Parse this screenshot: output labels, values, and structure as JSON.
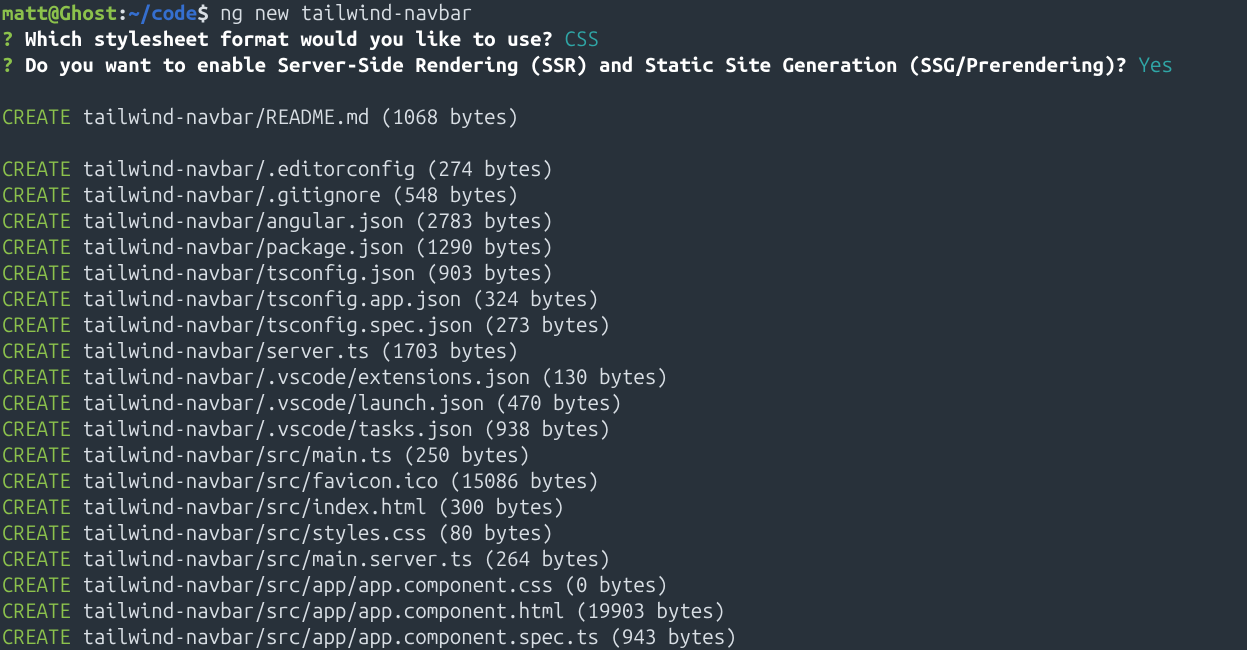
{
  "prompt": {
    "user": "matt@Ghost",
    "sep1": ":",
    "cwd": "~/code",
    "sep2": "$ ",
    "command": "ng new tailwind-navbar"
  },
  "questions": [
    {
      "marker": "?",
      "text": "Which stylesheet format would you like to use?",
      "answer": "CSS"
    },
    {
      "marker": "?",
      "text": "Do you want to enable Server-Side Rendering (SSR) and Static Site Generation (SSG/Prerendering)?",
      "answer": "Yes"
    }
  ],
  "segments": [
    [
      {
        "action": "CREATE",
        "text": " tailwind-navbar/README.md (1068 bytes)"
      }
    ],
    [
      {
        "action": "CREATE",
        "text": " tailwind-navbar/.editorconfig (274 bytes)"
      },
      {
        "action": "CREATE",
        "text": " tailwind-navbar/.gitignore (548 bytes)"
      },
      {
        "action": "CREATE",
        "text": " tailwind-navbar/angular.json (2783 bytes)"
      },
      {
        "action": "CREATE",
        "text": " tailwind-navbar/package.json (1290 bytes)"
      },
      {
        "action": "CREATE",
        "text": " tailwind-navbar/tsconfig.json (903 bytes)"
      },
      {
        "action": "CREATE",
        "text": " tailwind-navbar/tsconfig.app.json (324 bytes)"
      },
      {
        "action": "CREATE",
        "text": " tailwind-navbar/tsconfig.spec.json (273 bytes)"
      },
      {
        "action": "CREATE",
        "text": " tailwind-navbar/server.ts (1703 bytes)"
      },
      {
        "action": "CREATE",
        "text": " tailwind-navbar/.vscode/extensions.json (130 bytes)"
      },
      {
        "action": "CREATE",
        "text": " tailwind-navbar/.vscode/launch.json (470 bytes)"
      },
      {
        "action": "CREATE",
        "text": " tailwind-navbar/.vscode/tasks.json (938 bytes)"
      },
      {
        "action": "CREATE",
        "text": " tailwind-navbar/src/main.ts (250 bytes)"
      },
      {
        "action": "CREATE",
        "text": " tailwind-navbar/src/favicon.ico (15086 bytes)"
      },
      {
        "action": "CREATE",
        "text": " tailwind-navbar/src/index.html (300 bytes)"
      },
      {
        "action": "CREATE",
        "text": " tailwind-navbar/src/styles.css (80 bytes)"
      },
      {
        "action": "CREATE",
        "text": " tailwind-navbar/src/main.server.ts (264 bytes)"
      },
      {
        "action": "CREATE",
        "text": " tailwind-navbar/src/app/app.component.css (0 bytes)"
      },
      {
        "action": "CREATE",
        "text": " tailwind-navbar/src/app/app.component.html (19903 bytes)"
      },
      {
        "action": "CREATE",
        "text": " tailwind-navbar/src/app/app.component.spec.ts (943 bytes)"
      }
    ]
  ]
}
